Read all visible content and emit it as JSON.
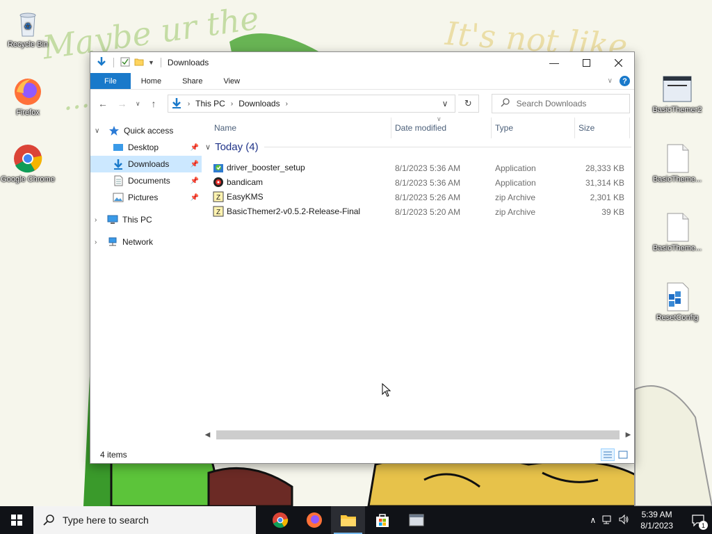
{
  "desktop": {
    "icons": [
      {
        "name": "recycle-bin",
        "label": "Recycle Bin"
      },
      {
        "name": "firefox",
        "label": "Firefox"
      },
      {
        "name": "google-chrome",
        "label": "Google Chrome"
      },
      {
        "name": "basicthemer2",
        "label": "BasicThemer2"
      },
      {
        "name": "basictheme-1",
        "label": "BasicTheme..."
      },
      {
        "name": "basictheme-2",
        "label": "BasicTheme..."
      },
      {
        "name": "resetconfig",
        "label": "ResetConfig"
      }
    ]
  },
  "window": {
    "title": "Downloads",
    "ribbon_tabs": [
      "File",
      "Home",
      "Share",
      "View"
    ],
    "address": {
      "segments": [
        "This PC",
        "Downloads"
      ]
    },
    "search": {
      "placeholder": "Search Downloads"
    },
    "navpane": {
      "quick_access": "Quick access",
      "items": [
        "Desktop",
        "Downloads",
        "Documents",
        "Pictures"
      ],
      "this_pc": "This PC",
      "network": "Network"
    },
    "columns": {
      "name": "Name",
      "date": "Date modified",
      "type": "Type",
      "size": "Size"
    },
    "group_label": "Today (4)",
    "files": [
      {
        "name": "driver_booster_setup",
        "date": "8/1/2023 5:36 AM",
        "type": "Application",
        "size": "28,333 KB",
        "icon": "installer-icon"
      },
      {
        "name": "bandicam",
        "date": "8/1/2023 5:36 AM",
        "type": "Application",
        "size": "31,314 KB",
        "icon": "bandicam-icon"
      },
      {
        "name": "EasyKMS",
        "date": "8/1/2023 5:26 AM",
        "type": "zip Archive",
        "size": "2,301 KB",
        "icon": "zip-icon"
      },
      {
        "name": "BasicThemer2-v0.5.2-Release-Final",
        "date": "8/1/2023 5:20 AM",
        "type": "zip Archive",
        "size": "39 KB",
        "icon": "zip-icon"
      }
    ],
    "status": "4 items"
  },
  "taskbar": {
    "search_placeholder": "Type here to search",
    "time": "5:39 AM",
    "date": "8/1/2023",
    "notification_count": "1"
  },
  "colors": {
    "accent": "#1979ca",
    "selection": "#cce8ff",
    "taskbar": "#101217",
    "group_text": "#1e3287"
  }
}
